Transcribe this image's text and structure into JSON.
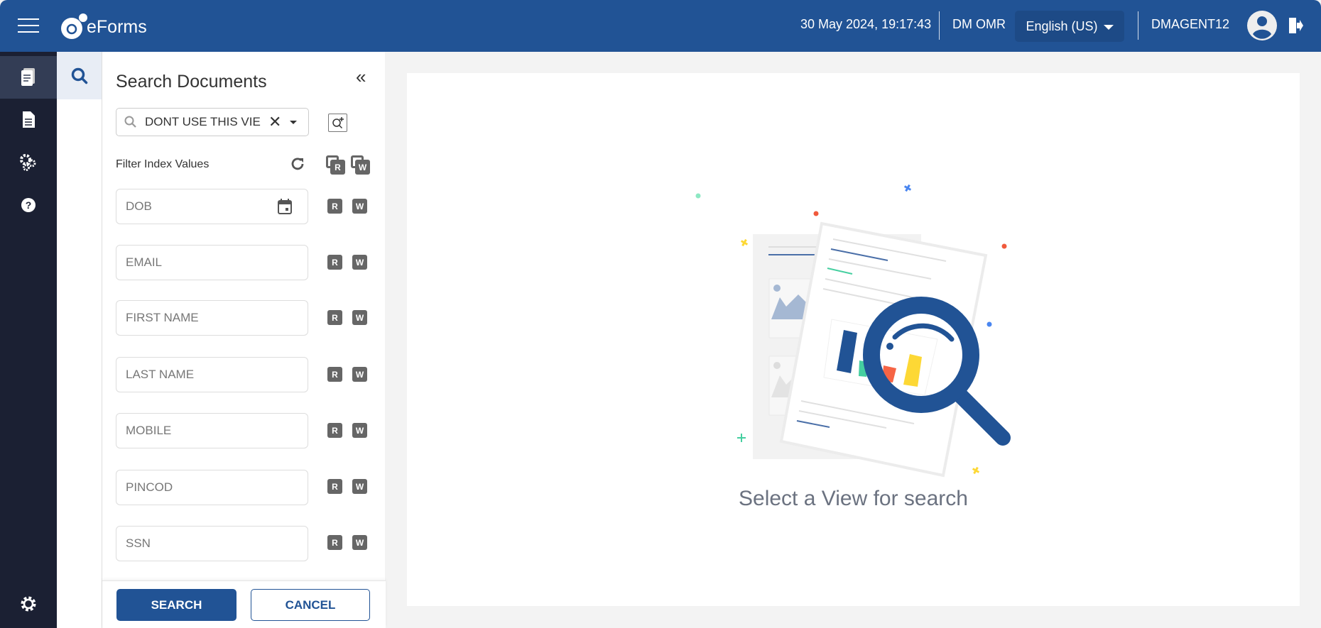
{
  "header": {
    "app_name": "eForms",
    "datetime": "30 May 2024, 19:17:43",
    "org": "DM OMR",
    "language": "English (US)",
    "username": "DMAGENT12",
    "brand_color": "#215395"
  },
  "rail": {
    "items": [
      "documents-icon",
      "form-list-icon",
      "settings-cogs-icon",
      "help-icon"
    ],
    "bottom": "gear-icon"
  },
  "panel": {
    "title": "Search Documents",
    "view_select": {
      "value": "DONT USE THIS VIE"
    },
    "filter_label": "Filter Index Values",
    "badge_r": "R",
    "badge_w": "W",
    "fields": [
      {
        "placeholder": "DOB"
      },
      {
        "placeholder": "EMAIL"
      },
      {
        "placeholder": "FIRST NAME"
      },
      {
        "placeholder": "LAST NAME"
      },
      {
        "placeholder": "MOBILE"
      },
      {
        "placeholder": "PINCOD"
      },
      {
        "placeholder": "SSN"
      }
    ],
    "search_label": "SEARCH",
    "cancel_label": "CANCEL"
  },
  "main": {
    "empty_message": "Select a View for search"
  }
}
